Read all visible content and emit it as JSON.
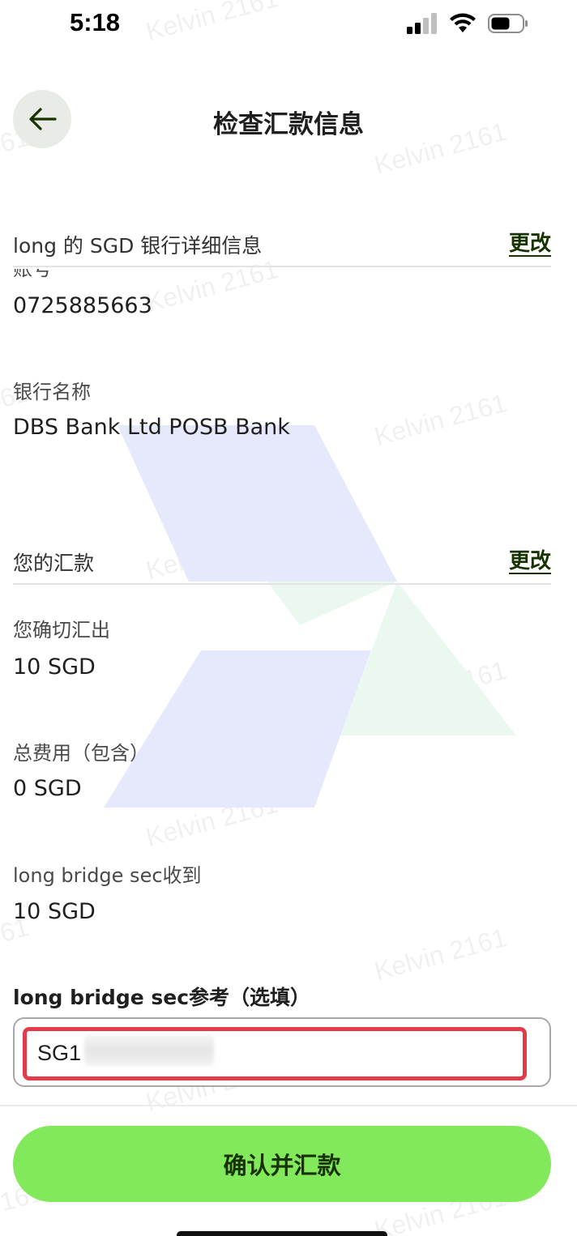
{
  "status_bar": {
    "time": "5:18",
    "icons": [
      "signal-icon",
      "wifi-icon",
      "battery-icon"
    ]
  },
  "header": {
    "title": "检查汇款信息",
    "back_icon": "arrow-left-icon"
  },
  "watermark": {
    "text": "Kelvin 2161",
    "fragment_a": "61",
    "fragment_b": "161"
  },
  "bank_section": {
    "title": "long 的 SGD 银行详细信息",
    "change_label": "更改",
    "fields": [
      {
        "label": "账号",
        "value": "0725885663"
      },
      {
        "label": "银行名称",
        "value": "DBS Bank Ltd POSB Bank"
      }
    ]
  },
  "transfer_section": {
    "title": "您的汇款",
    "change_label": "更改",
    "fields": [
      {
        "label": "您确切汇出",
        "value": "10 SGD"
      },
      {
        "label": "总费用（包含）",
        "value": "0 SGD"
      },
      {
        "label": "long bridge sec收到",
        "value": "10 SGD"
      }
    ]
  },
  "reference": {
    "label": "long bridge sec参考（选填）",
    "value": "SG1"
  },
  "confirm_button": {
    "label": "确认并汇款"
  },
  "colors": {
    "accent_green": "#83e95c",
    "dark_green": "#163300",
    "highlight_red": "#e23b4a",
    "logo_blue": "#e6e8fb",
    "logo_green": "#eaf8f0"
  }
}
